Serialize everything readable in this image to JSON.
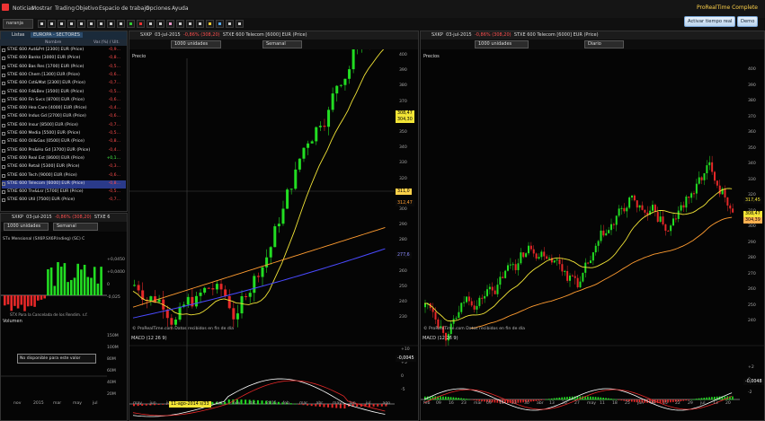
{
  "menu": [
    "Noticias",
    "Mostrar",
    "Trading",
    "Objetivo",
    "Espacio de trabajo",
    "Opciones",
    "Ayuda"
  ],
  "brand": "ProRealTime Complete",
  "toolbar": {
    "select_value": "naranja"
  },
  "top_buttons": [
    "Activar tiempo real",
    "Demo"
  ],
  "watchlist": {
    "title_prefix": "Listas",
    "title_name": "EUROPA - SECTORES",
    "columns": [
      "Nombre",
      "Var.(%) / Ult."
    ],
    "rows": [
      {
        "name": "STXE 600 Aut&Prt [2300] EUR (Price)",
        "value": "-0,9...",
        "pos": false,
        "sel": false
      },
      {
        "name": "STXE 600 Banks [3000] EUR (Price)",
        "value": "-0,8...",
        "pos": false,
        "sel": false
      },
      {
        "name": "STXE 600 Bas Res [1700] EUR (Price)",
        "value": "-0,5...",
        "pos": false,
        "sel": false
      },
      {
        "name": "STXE 600 Chem [1300] EUR (Price)",
        "value": "-0,6...",
        "pos": false,
        "sel": false
      },
      {
        "name": "STXE 600 Cst&Mat [2300] EUR (Price)",
        "value": "-0,7...",
        "pos": false,
        "sel": false
      },
      {
        "name": "STXE 600 Fd&Bev [3500] EUR (Price)",
        "value": "-0,5...",
        "pos": false,
        "sel": false
      },
      {
        "name": "STXE 600 Fin Svcs [8700] EUR (Price)",
        "value": "-0,6...",
        "pos": false,
        "sel": false
      },
      {
        "name": "STXE 600 Hea Care [4000] EUR (Price)",
        "value": "-0,4...",
        "pos": false,
        "sel": false
      },
      {
        "name": "STXE 600 Indus Gd [2700] EUR (Price)",
        "value": "-0,6...",
        "pos": false,
        "sel": false
      },
      {
        "name": "STXE 600 Insur [8500] EUR (Price)",
        "value": "-0,7...",
        "pos": false,
        "sel": false
      },
      {
        "name": "STXE 600 Media [5500] EUR (Price)",
        "value": "-0,5...",
        "pos": false,
        "sel": false
      },
      {
        "name": "STXE 600 Oil&Gas [0500] EUR (Price)",
        "value": "-0,8...",
        "pos": false,
        "sel": false
      },
      {
        "name": "STXE 600 Prs&Ho Gd [3700] EUR (Price)",
        "value": "-0,4...",
        "pos": false,
        "sel": false
      },
      {
        "name": "STXE 600 Real Est [8600] EUR (Price)",
        "value": "+0,1...",
        "pos": true,
        "sel": false
      },
      {
        "name": "STXE 600 Retail [5300] EUR (Price)",
        "value": "-0,3...",
        "pos": false,
        "sel": false
      },
      {
        "name": "STXE 600 Tech [9000] EUR (Price)",
        "value": "-0,6...",
        "pos": false,
        "sel": false
      },
      {
        "name": "STXE 600 Telecom [6000] EUR (Price)",
        "value": "-0,8...",
        "pos": false,
        "sel": true
      },
      {
        "name": "STXE 600 Trv&Lsr [5700] EUR (Price)",
        "value": "-0,5...",
        "pos": false,
        "sel": false
      },
      {
        "name": "STXE 600 Util [7500] EUR (Price)",
        "value": "-0,7...",
        "pos": false,
        "sel": false
      }
    ]
  },
  "small_chart": {
    "title_ticker": "SXKP",
    "title_date": "03-jul-2015",
    "title_change": "-0,86% (308,20)",
    "title_name": "STXE 6",
    "dd_units": "1000 unidades",
    "dd_period": "Semanal",
    "indicator_title": "STx Mensional (SX6P.SX6P.Indieg) (SC) C",
    "indicator_ticks": [
      "+0,0450",
      "+0,0400",
      "0",
      "-0,025"
    ],
    "indicator_footer": "STX Para la Cancelada de los Rendim. s.f.",
    "volume_title": "Volumen",
    "volume_ticks": [
      "150M",
      "100M",
      "80M",
      "60M",
      "40M",
      "20M"
    ],
    "tooltip": "No disponible para este valor",
    "x_ticks": [
      "nov",
      "2015",
      "mar",
      "may",
      "jul"
    ]
  },
  "weekly_chart": {
    "title_ticker": "SXKP",
    "title_date": "03-jul-2015",
    "title_change": "-0,86% (308,20)",
    "title_name": "STXE 600 Telecom [6000] EUR (Price)",
    "dd_units": "1000 unidades",
    "dd_period": "Semanal",
    "label": "Precio",
    "footer": "© ProRealTime.com Datos recibidos en fin de día",
    "macd_title": "MACD (12 26 9)",
    "y_ticks": [
      "400",
      "390",
      "380",
      "370",
      "360",
      "350",
      "340",
      "330",
      "320",
      "310",
      "300",
      "290",
      "280",
      "270",
      "260",
      "250",
      "240",
      "230"
    ],
    "price_tags": [
      {
        "text": "308,47",
        "color": "#f2e436",
        "fg": "#000"
      },
      {
        "text": "304,30",
        "color": "#f2e436",
        "fg": "#000"
      },
      {
        "text": "311,0",
        "color": "#ffd24a",
        "fg": "#000"
      },
      {
        "text": "312,47",
        "color": "#0a0a0a",
        "fg": "#ff9c30"
      },
      {
        "text": "277,6",
        "color": "#0a0a0a",
        "fg": "#8a8aff"
      }
    ],
    "macd_ticks": [
      "+10",
      "+5",
      "0",
      "-5"
    ],
    "macd_tag": "-0,0045",
    "x_ticks": [
      "may",
      "jun",
      "jul",
      "ago",
      "sep",
      "oct",
      "nov",
      "dic",
      "2015",
      "feb",
      "mar",
      "abr",
      "may",
      "jun",
      "jul",
      "ago"
    ],
    "cursor_tag": "11-ago-2014 s/33"
  },
  "daily_chart": {
    "title_ticker": "SXKP",
    "title_date": "03-jul-2015",
    "title_change": "-0,86% (308,20)",
    "title_name": "STXE 600 Telecom [6000] EUR (Price)",
    "dd_units": "1000 unidades",
    "dd_period": "Diario",
    "label": "Precios",
    "footer": "© ProRealTime.com Datos recibidos en fin de día",
    "macd_title": "MACD (12 26 9)",
    "y_ticks": [
      "400",
      "390",
      "380",
      "370",
      "360",
      "350",
      "340",
      "330",
      "320",
      "310",
      "300",
      "290",
      "280",
      "270",
      "260",
      "250",
      "240"
    ],
    "price_tags": [
      {
        "text": "317,45",
        "color": "#0a0a0a",
        "fg": "#f2e436"
      },
      {
        "text": "308,47",
        "color": "#f2e436",
        "fg": "#000"
      },
      {
        "text": "304,39",
        "color": "#ffb050",
        "fg": "#000"
      }
    ],
    "macd_ticks": [
      "+2",
      "0",
      "-2"
    ],
    "macd_tag": "-0,0048",
    "x_ticks": [
      "feb",
      "09",
      "16",
      "23",
      "mar",
      "09",
      "16",
      "23",
      "30",
      "abr",
      "13",
      "20",
      "27",
      "may",
      "11",
      "18",
      "25",
      "jun",
      "08",
      "15",
      "22",
      "29",
      "jul",
      "13",
      "20"
    ]
  }
}
